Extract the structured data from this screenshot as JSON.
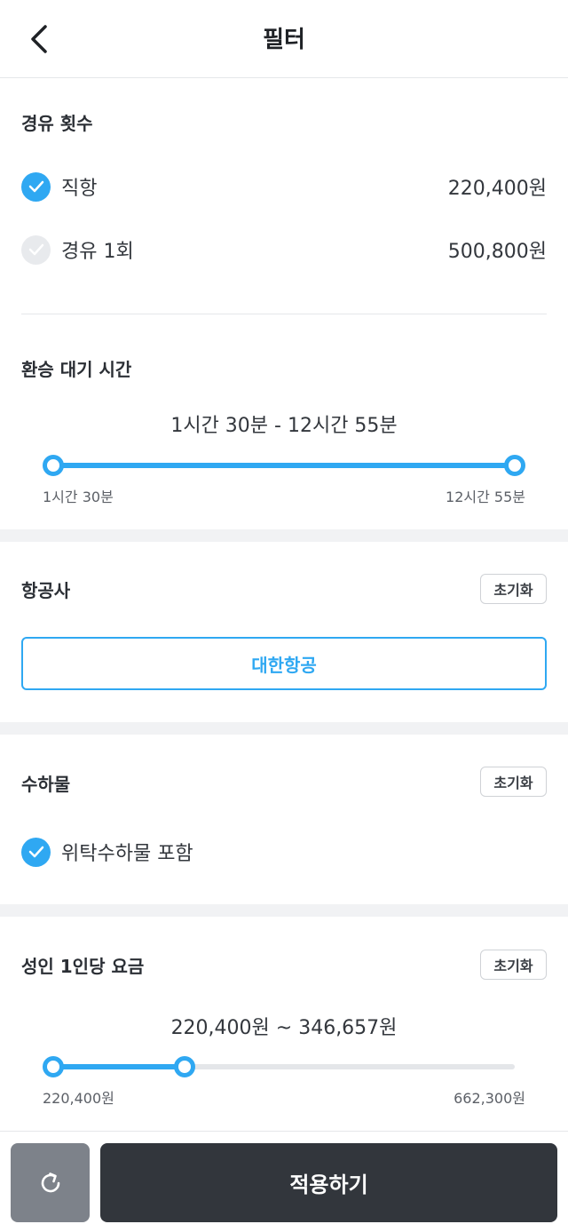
{
  "header": {
    "title": "필터",
    "back_icon": "chevron-left-icon"
  },
  "stops": {
    "title": "경유 횟수",
    "options": [
      {
        "label": "직항",
        "price": "220,400원",
        "checked": true
      },
      {
        "label": "경유 1회",
        "price": "500,800원",
        "checked": false
      }
    ]
  },
  "layover": {
    "title": "환승 대기 시간",
    "range_text": "1시간 30분 - 12시간 55분",
    "min_label": "1시간 30분",
    "max_label": "12시간 55분",
    "selected_min_fraction": 0.0,
    "selected_max_fraction": 1.0
  },
  "airline": {
    "title": "항공사",
    "reset_label": "초기화",
    "selected": "대한항공"
  },
  "baggage": {
    "title": "수하물",
    "reset_label": "초기화",
    "option": {
      "label": "위탁수하물 포함",
      "checked": true
    }
  },
  "fare": {
    "title": "성인 1인당 요금",
    "reset_label": "초기화",
    "range_text": "220,400원 ~ 346,657원",
    "min_label": "220,400원",
    "max_label": "662,300원",
    "selected_min_fraction": 0.0,
    "selected_max_fraction": 0.285
  },
  "footer": {
    "refresh_icon": "refresh-icon",
    "apply_label": "적용하기"
  },
  "colors": {
    "accent": "#2fa8f2",
    "dark_button": "#32363c",
    "gray_button": "#7d828a"
  }
}
